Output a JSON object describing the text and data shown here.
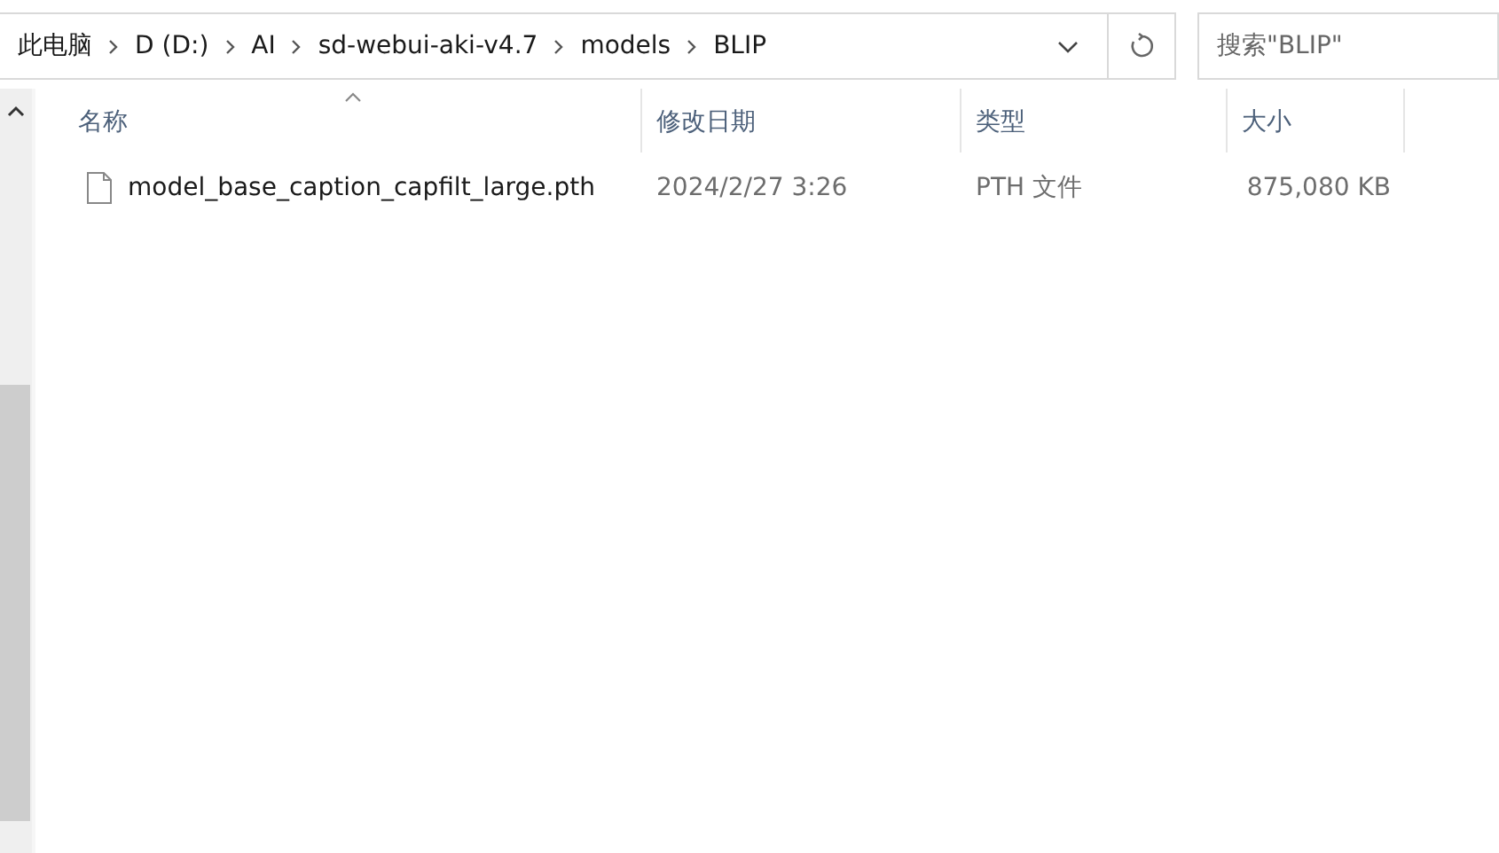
{
  "breadcrumb": [
    "此电脑",
    "D (D:)",
    "AI",
    "sd-webui-aki-v4.7",
    "models",
    "BLIP"
  ],
  "search": {
    "placeholder": "搜索\"BLIP\""
  },
  "columns": [
    {
      "label": "名称",
      "sorted": true
    },
    {
      "label": "修改日期",
      "sorted": false
    },
    {
      "label": "类型",
      "sorted": false
    },
    {
      "label": "大小",
      "sorted": false
    }
  ],
  "files": [
    {
      "name": "model_base_caption_capfilt_large.pth",
      "modified": "2024/2/27 3:26",
      "type": "PTH 文件",
      "size": "875,080 KB"
    }
  ]
}
